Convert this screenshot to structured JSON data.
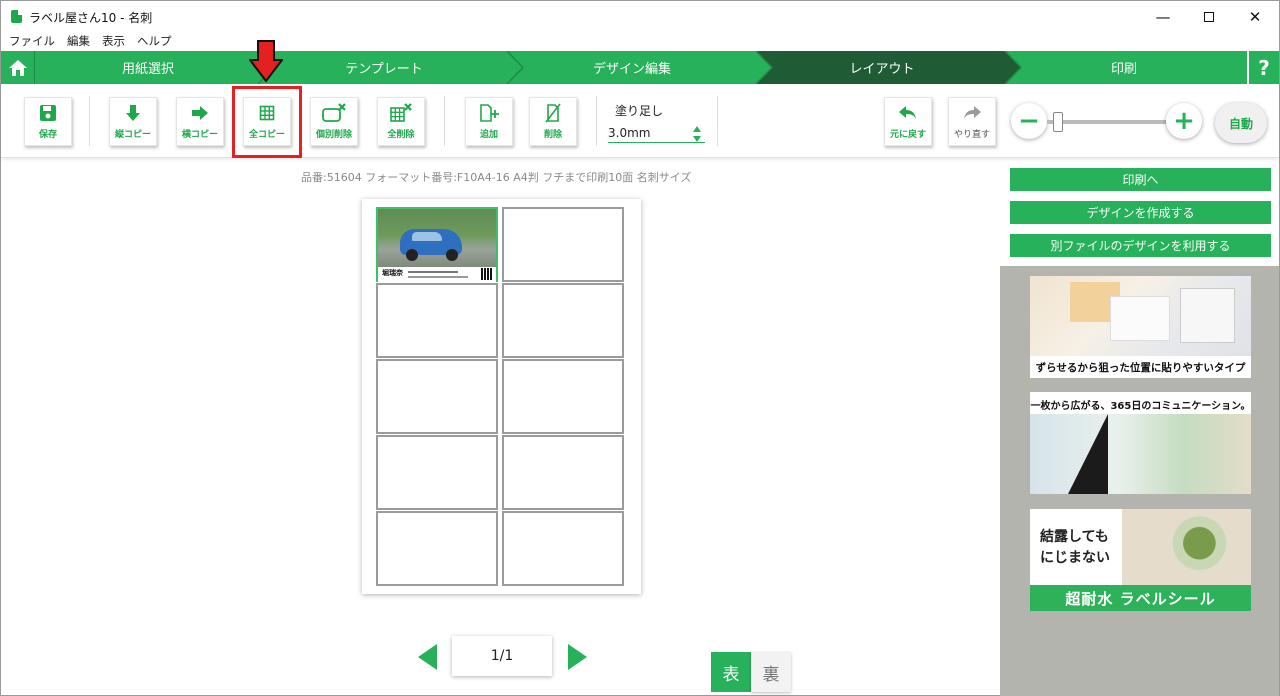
{
  "window": {
    "title": "ラベル屋さん10 - 名刺",
    "minimize": "—",
    "close": "✕"
  },
  "menu": [
    "ファイル",
    "編集",
    "表示",
    "ヘルプ"
  ],
  "steps": [
    "用紙選択",
    "テンプレート",
    "デザイン編集",
    "レイアウト",
    "印刷"
  ],
  "active_step": "レイアウト",
  "help_label": "?",
  "toolbar": {
    "save": "保存",
    "vertical_copy": "縦コピー",
    "horizontal_copy": "横コピー",
    "all_copy": "全コピー",
    "individual_delete": "個別削除",
    "all_delete": "全削除",
    "add": "追加",
    "delete": "削除",
    "bleed_label": "塗り足し",
    "bleed_value": "3.0mm",
    "undo": "元に戻す",
    "redo": "やり直す",
    "zoom_out": "−",
    "zoom_in": "+",
    "auto": "自動"
  },
  "zoom_level": 0.05,
  "info_line": "品番:51604 フォーマット番号:F10A4-16 A4判 フチまで印刷10面 名刺サイズ",
  "card": {
    "name": "堀瑞奈"
  },
  "pager": {
    "page": "1/1"
  },
  "face": {
    "front": "表",
    "back": "裏"
  },
  "side_buttons": {
    "to_print": "印刷へ",
    "create_design": "デザインを作成する",
    "use_other_file": "別ファイルのデザインを利用する"
  },
  "ads": {
    "ad1_caption": "ずらせるから狙った位置に貼りやすいタイプ",
    "ad2_caption": "一枚から広がる、365日のコミュニケーション。",
    "ad3_line1": "結露しても",
    "ad3_line2": "にじまない",
    "ad3_bar": "超耐水 ラベルシール"
  },
  "colors": {
    "accent": "#27b15a",
    "active_step": "#1f5c35",
    "highlight": "#e52020"
  }
}
